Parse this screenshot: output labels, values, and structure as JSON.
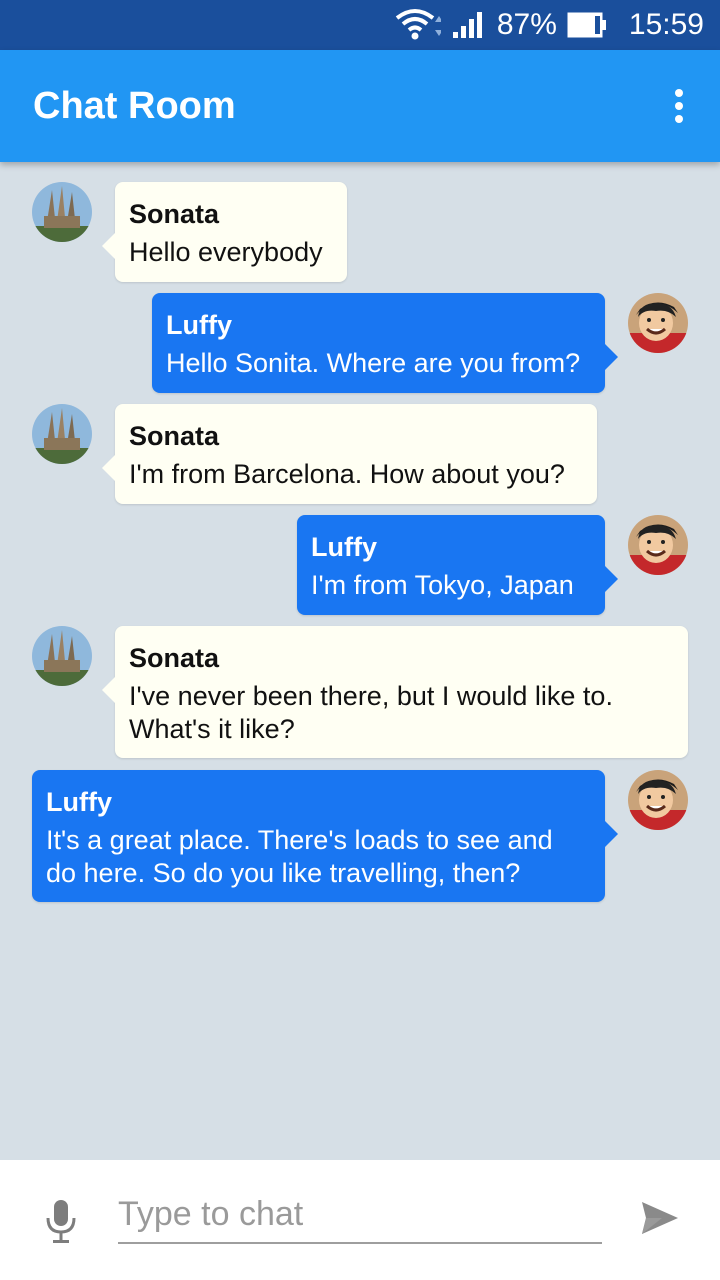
{
  "status_bar": {
    "battery": "87%",
    "time": "15:59"
  },
  "app_bar": {
    "title": "Chat Room",
    "menu_icon": "more-vert-icon"
  },
  "messages": [
    {
      "sender": "Sonata",
      "text": "Hello everybody",
      "side": "left"
    },
    {
      "sender": "Luffy",
      "text": "Hello Sonita. Where are you from?",
      "side": "right"
    },
    {
      "sender": "Sonata",
      "text": "I'm from Barcelona. How about you?",
      "side": "left"
    },
    {
      "sender": "Luffy",
      "text": "I'm from Tokyo, Japan",
      "side": "right"
    },
    {
      "sender": "Sonata",
      "text": "I've never been there, but I would like to.\nWhat's it like?",
      "side": "left"
    },
    {
      "sender": "Luffy",
      "text": "It's a great place. There's loads to see and\ndo here. So do you like travelling, then?",
      "side": "right"
    }
  ],
  "input": {
    "placeholder": "Type to chat",
    "value": ""
  },
  "icons": {
    "mic": "mic-icon",
    "send": "send-icon"
  },
  "colors": {
    "status_bar": "#1a4f9c",
    "app_bar": "#2196f3",
    "outgoing_bubble": "#1976f2",
    "incoming_bubble": "#fffff3",
    "chat_background": "#d6dfe6"
  }
}
